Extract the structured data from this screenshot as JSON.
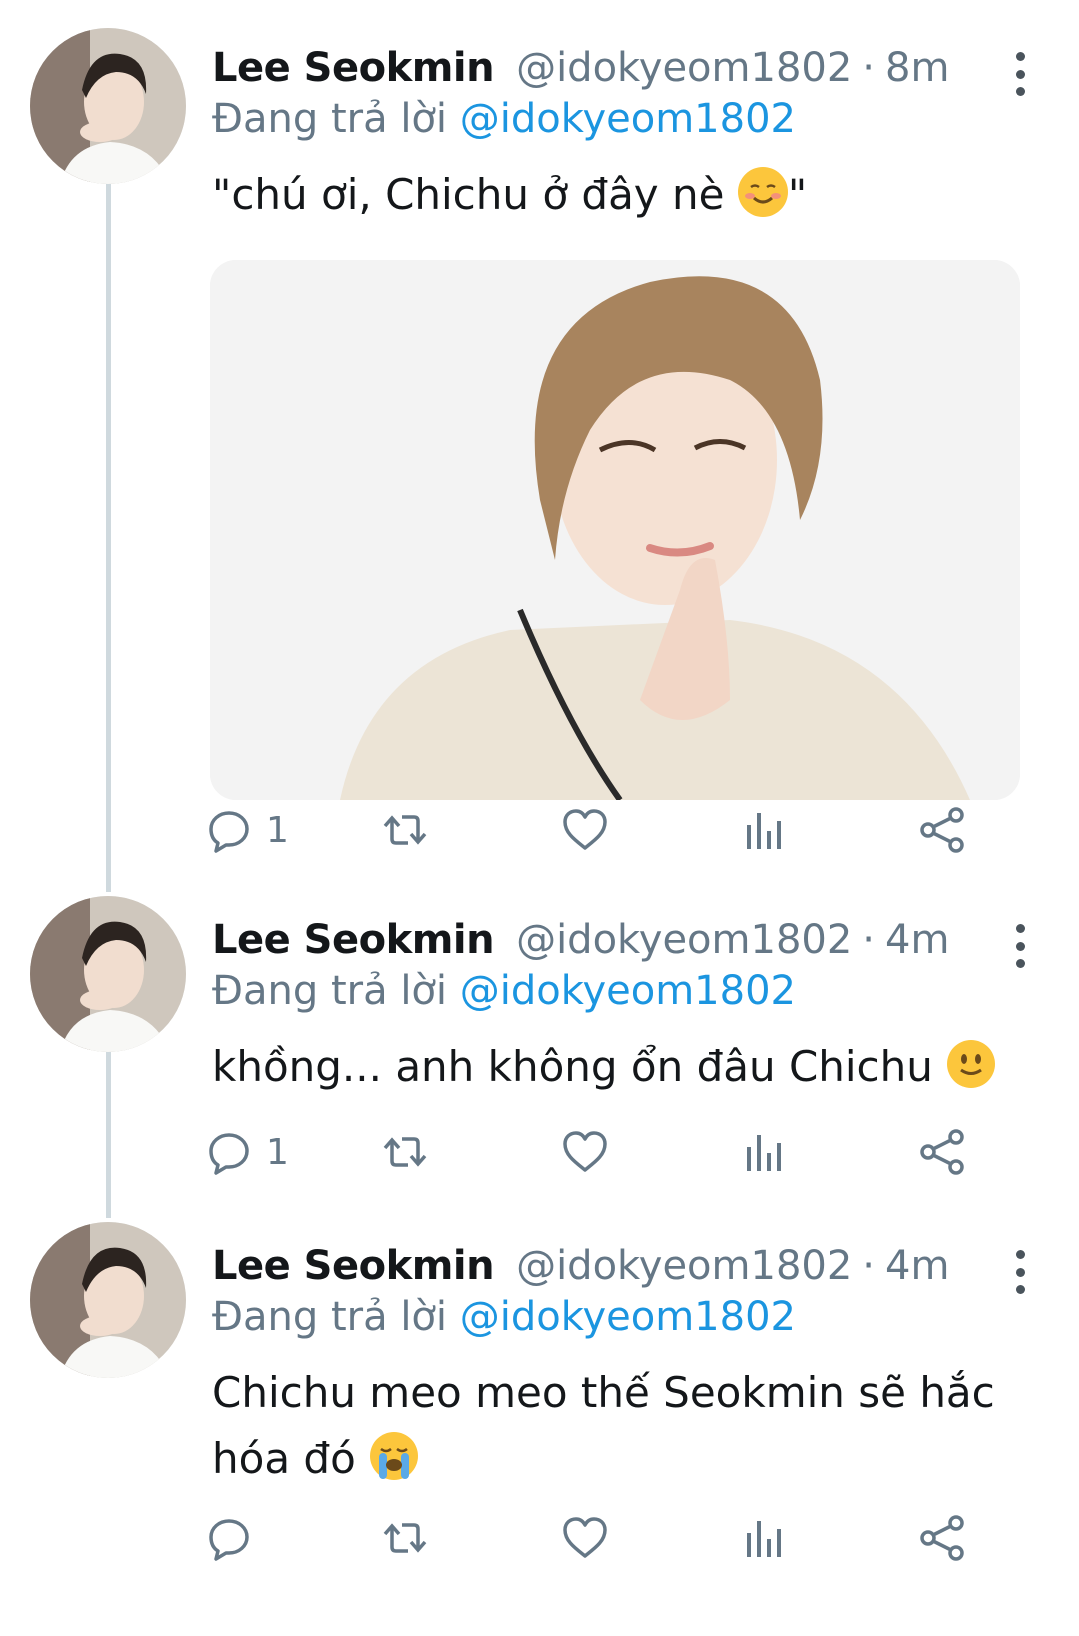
{
  "colors": {
    "accent": "#1b95e0",
    "secondary_text": "#657786",
    "icon": "#657786",
    "thread_line": "#cfd9de"
  },
  "tweets": [
    {
      "name": "Lee Seokmin",
      "handle": "@idokyeom1802",
      "separator": "·",
      "time": "8m",
      "reply_prefix": "Đang trả lời",
      "reply_to": "@idokyeom1802",
      "text": "\"chú ơi, Chichu ở đây nè ",
      "text_after_emoji": "\"",
      "emoji": "smiling-face-emoji",
      "has_media": true,
      "reply_count": "1"
    },
    {
      "name": "Lee Seokmin",
      "handle": "@idokyeom1802",
      "separator": "·",
      "time": "4m",
      "reply_prefix": "Đang trả lời",
      "reply_to": "@idokyeom1802",
      "text": "khồng... anh không ổn đâu Chichu ",
      "emoji": "slightly-smiling-face-emoji",
      "has_media": false,
      "reply_count": "1"
    },
    {
      "name": "Lee Seokmin",
      "handle": "@idokyeom1802",
      "separator": "·",
      "time": "4m",
      "reply_prefix": "Đang trả lời",
      "reply_to": "@idokyeom1802",
      "text_line1": "Chichu meo meo thế Seokmin sẽ hắc",
      "text_line2": "hóa đó ",
      "emoji": "loudly-crying-face-emoji",
      "has_media": false,
      "reply_count": ""
    }
  ],
  "action_icons": [
    "reply-icon",
    "retweet-icon",
    "like-icon",
    "analytics-icon",
    "share-icon"
  ]
}
